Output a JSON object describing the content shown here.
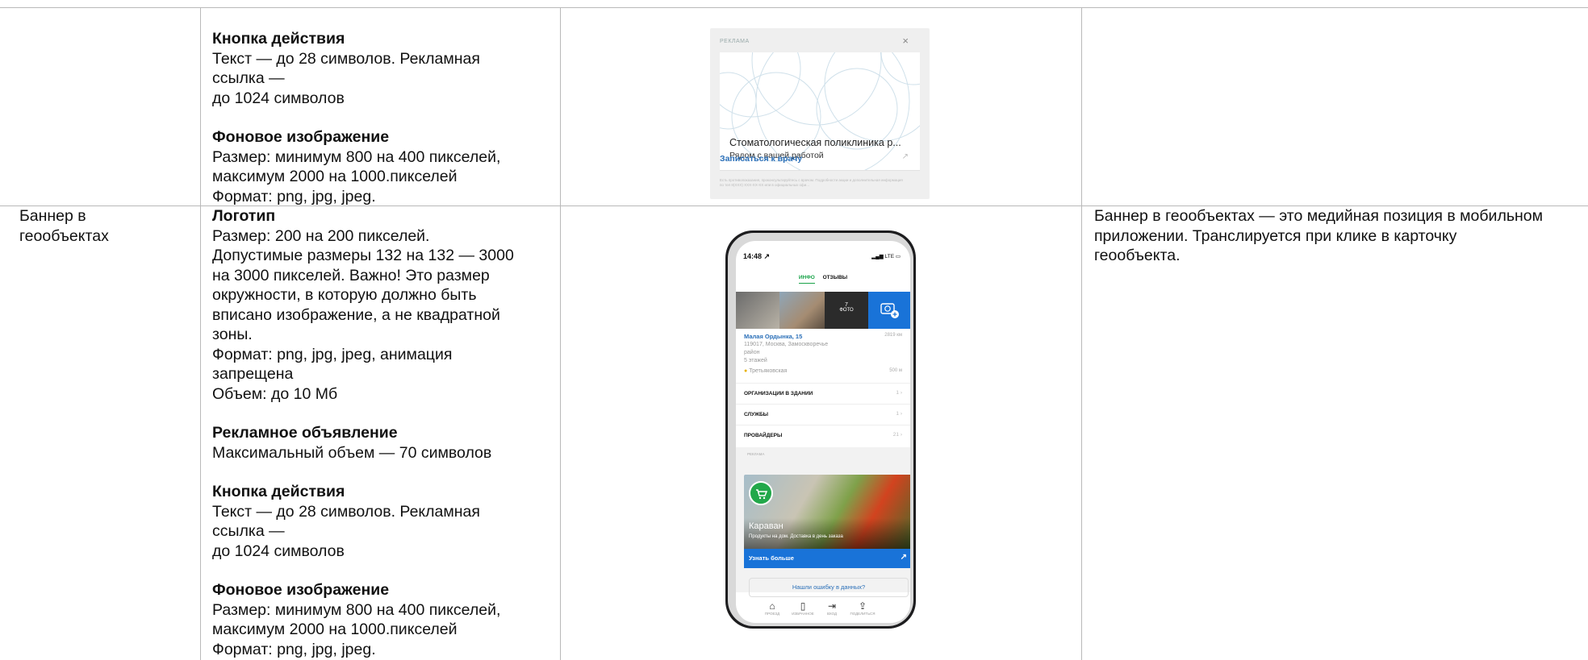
{
  "colors": {
    "grid": "#b9b9b9",
    "link_blue": "#2a6fb8",
    "accent_green": "#1aa34a",
    "button_blue": "#1973d8"
  },
  "row1": {
    "specs": [
      {
        "heading": "Кнопка действия",
        "lines": [
          "Текст — до 28 символов. Рекламная",
          "ссылка —",
          "до 1024 символов"
        ]
      },
      {
        "heading": "Фоновое изображение",
        "lines": [
          "Размер: минимум 800 на 400 пикселей,",
          "максимум 2000 на 1000.пикселей",
          "Формат: png, jpg, jpeg."
        ]
      }
    ],
    "ad_preview": {
      "label": "РЕКЛАМА",
      "close": "×",
      "title": "Стоматологическая поликлиника р...",
      "subtitle": "Рядом с вашей работой",
      "action": "Записаться к врачу",
      "fine_print": "Есть противопоказания, проконсультируйтесь с врачом. Подробности акции и дополнительная информация по тел 8(XXX) XXX-XX-XX или в официальных офи..."
    }
  },
  "row2": {
    "name_lines": [
      "Баннер в",
      "геообъектах"
    ],
    "specs": [
      {
        "heading": "Логотип",
        "lines": [
          "Размер: 200 на 200 пикселей.",
          "Допустимые размеры 132 на 132 — 3000",
          "на 3000 пикселей. Важно! Это размер",
          "окружности, в которую должно быть",
          "вписано изображение, а не квадратной",
          "зоны.",
          "Формат: png, jpg, jpeg, анимация",
          "запрещена",
          "Объем: до 10 Мб"
        ]
      },
      {
        "heading": "Рекламное объявление",
        "lines": [
          "Максимальный объем — 70 символов"
        ]
      },
      {
        "heading": "Кнопка действия",
        "lines": [
          "Текст — до 28 символов. Рекламная",
          "ссылка —",
          "до 1024 символов"
        ]
      },
      {
        "heading": "Фоновое изображение",
        "lines": [
          "Размер: минимум 800 на 400 пикселей,",
          "максимум 2000 на 1000.пикселей",
          "Формат: png, jpg, jpeg."
        ]
      }
    ],
    "description_lines": [
      "Баннер в геообъектах — это медийная позиция в мобильном",
      "приложении. Транслируется при клике в карточку",
      "геообъекта."
    ],
    "phone": {
      "time": "14:48 ↗",
      "network": "LTE",
      "tab_info": "ИНФО",
      "tab_reviews": "ОТЗЫВЫ",
      "photo_count": "7",
      "photo_label": "ФОТО",
      "address": "Малая Ордынка, 15",
      "distance": "2819 км",
      "address_lines": [
        "119017, Москва, Замоскворечье",
        "район",
        "5 этажей"
      ],
      "metro": "Третьяковская",
      "metro_distance": "500 м",
      "rows": [
        {
          "label": "ОРГАНИЗАЦИИ В ЗДАНИИ",
          "count": "1"
        },
        {
          "label": "СЛУЖБЫ",
          "count": "1"
        },
        {
          "label": "ПРОВАЙДЕРЫ",
          "count": "21"
        }
      ],
      "ad_label": "РЕКЛАМА",
      "ad_title": "Караван",
      "ad_subtitle": "Продукты на дом. Доставка в день заказа",
      "ad_button": "Узнать больше",
      "error_link": "Нашли ошибку в данных?",
      "bottom_tabs": [
        "ПРОЕЗД",
        "ИЗБРАННОЕ",
        "ВХОД",
        "ПОДЕЛИТЬСЯ"
      ]
    }
  }
}
